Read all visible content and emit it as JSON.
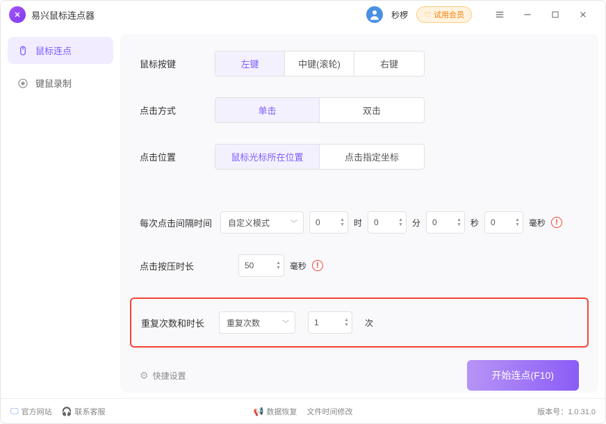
{
  "app": {
    "title": "易兴鼠标连点器"
  },
  "user": {
    "name": "秒椤",
    "badge": "试用会员"
  },
  "sidebar": {
    "items": [
      {
        "label": "鼠标连点"
      },
      {
        "label": "键鼠录制"
      }
    ]
  },
  "main": {
    "mouseButton": {
      "label": "鼠标按键",
      "options": [
        "左键",
        "中键(滚轮)",
        "右键"
      ]
    },
    "clickType": {
      "label": "点击方式",
      "options": [
        "单击",
        "双击"
      ]
    },
    "clickPos": {
      "label": "点击位置",
      "options": [
        "鼠标光标所在位置",
        "点击指定坐标"
      ]
    },
    "interval": {
      "label": "每次点击间隔时间",
      "mode": "自定义模式",
      "h": "0",
      "hUnit": "时",
      "m": "0",
      "mUnit": "分",
      "s": "0",
      "sUnit": "秒",
      "ms": "0",
      "msUnit": "毫秒"
    },
    "pressDuration": {
      "label": "点击按压时长",
      "value": "50",
      "unit": "毫秒"
    },
    "repeat": {
      "label": "重复次数和时长",
      "mode": "重复次数",
      "value": "1",
      "unit": "次"
    },
    "quickSettings": "快捷设置",
    "startButton": "开始连点(F10)"
  },
  "footer": {
    "website": "官方网站",
    "support": "联系客服",
    "dataRecovery": "数据恢复",
    "fileTime": "文件时间修改",
    "versionLabel": "版本号：",
    "version": "1.0.31.0"
  }
}
